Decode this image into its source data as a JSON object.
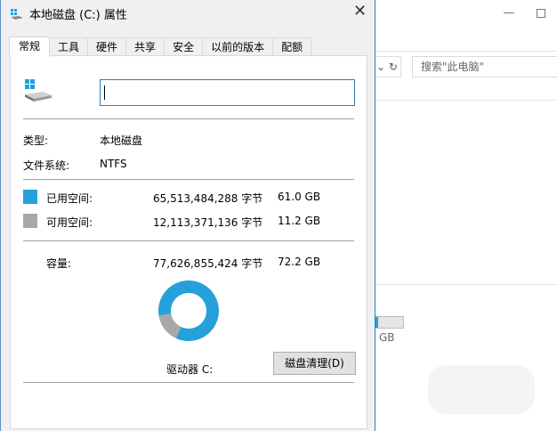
{
  "background_window": {
    "search_placeholder": "搜索\"此电脑\"",
    "refresh_glyph": "↻",
    "dropdown_glyph": "⌄",
    "size_unit": "GB",
    "used_fraction": 0.1
  },
  "dialog": {
    "title": "本地磁盘 (C:) 属性",
    "close_glyph": "✕",
    "tabs": [
      {
        "label": "常规",
        "active": true
      },
      {
        "label": "工具"
      },
      {
        "label": "硬件"
      },
      {
        "label": "共享"
      },
      {
        "label": "安全"
      },
      {
        "label": "以前的版本"
      },
      {
        "label": "配额"
      }
    ],
    "name_value": "",
    "type_label": "类型:",
    "type_value": "本地磁盘",
    "fs_label": "文件系统:",
    "fs_value": "NTFS",
    "used": {
      "label": "已用空间:",
      "bytes": "65,513,484,288 字节",
      "size": "61.0 GB",
      "color": "#26a0da"
    },
    "free": {
      "label": "可用空间:",
      "bytes": "12,113,371,136 字节",
      "size": "11.2 GB",
      "color": "#a8a8a8"
    },
    "capacity": {
      "label": "容量:",
      "bytes": "77,626,855,424 字节",
      "size": "72.2 GB"
    },
    "used_fraction": 0.844,
    "drive_label": "驱动器 C:",
    "cleanup_button": "磁盘清理(D)"
  }
}
